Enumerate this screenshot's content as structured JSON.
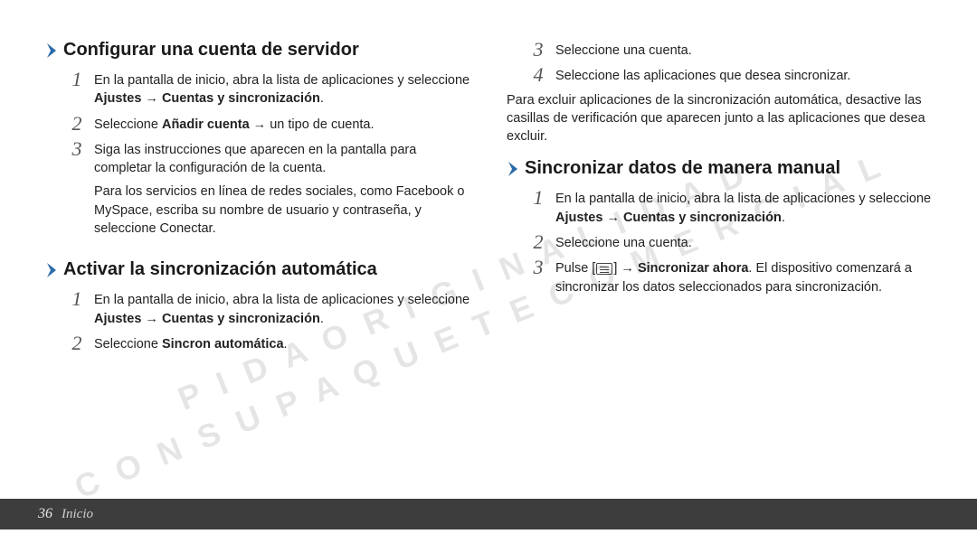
{
  "footer": {
    "page_number": "36",
    "section_label": "Inicio"
  },
  "left": {
    "section1": {
      "title": "Configurar una cuenta de servidor",
      "step1": {
        "num": "1",
        "text_a": "En la pantalla de inicio, abra la lista de aplicaciones y seleccione ",
        "bold_a": "Ajustes",
        "arrow": " → ",
        "bold_b": "Cuentas y sincronización",
        "text_b": "."
      },
      "step2": {
        "num": "2",
        "text_a": "Seleccione ",
        "bold_a": "Añadir cuenta",
        "arrow": " → ",
        "text_b": "un tipo de cuenta."
      },
      "step3": {
        "num": "3",
        "text": "Siga las instrucciones que aparecen en la pantalla para completar la configuración de la cuenta."
      },
      "note": {
        "text_a": "Para los servicios en línea de redes sociales, como Facebook o MySpace, escriba su nombre de usuario y contraseña, y seleccione ",
        "bold_a": "Conectar",
        "text_b": "."
      }
    },
    "section2": {
      "title": "Activar la sincronización automática",
      "step1": {
        "num": "1",
        "text_a": "En la pantalla de inicio, abra la lista de aplicaciones y seleccione ",
        "bold_a": "Ajustes",
        "arrow": " → ",
        "bold_b": "Cuentas y sincronización",
        "text_b": "."
      },
      "step2": {
        "num": "2",
        "text_a": "Seleccione ",
        "bold_a": "Sincron automática",
        "text_b": "."
      }
    }
  },
  "right": {
    "cont": {
      "step3": {
        "num": "3",
        "text": "Seleccione una cuenta."
      },
      "step4": {
        "num": "4",
        "text": "Seleccione las aplicaciones que desea sincronizar."
      },
      "extra": "Para excluir aplicaciones de la sincronización automática, desactive las casillas de verificación que aparecen junto a las aplicaciones que desea excluir."
    },
    "section3": {
      "title": "Sincronizar datos de manera manual",
      "step1": {
        "num": "1",
        "text_a": "En la pantalla de inicio, abra la lista de aplicaciones y seleccione ",
        "bold_a": "Ajustes",
        "arrow": " → ",
        "bold_b": "Cuentas y sincronización",
        "text_b": "."
      },
      "step2": {
        "num": "2",
        "text": "Seleccione una cuenta."
      },
      "step3": {
        "num": "3",
        "text_a": "Pulse [",
        "text_b": "] → ",
        "bold_a": "Sincronizar ahora",
        "text_c": ". El dispositivo comenzará a sincronizar los datos seleccionados para sincronización."
      }
    }
  },
  "watermark": {
    "line1": "P I D A   O R I G I N A L I D A D",
    "line2": "C O N   S U   P A Q U E T E   C O M E R C I A L"
  }
}
